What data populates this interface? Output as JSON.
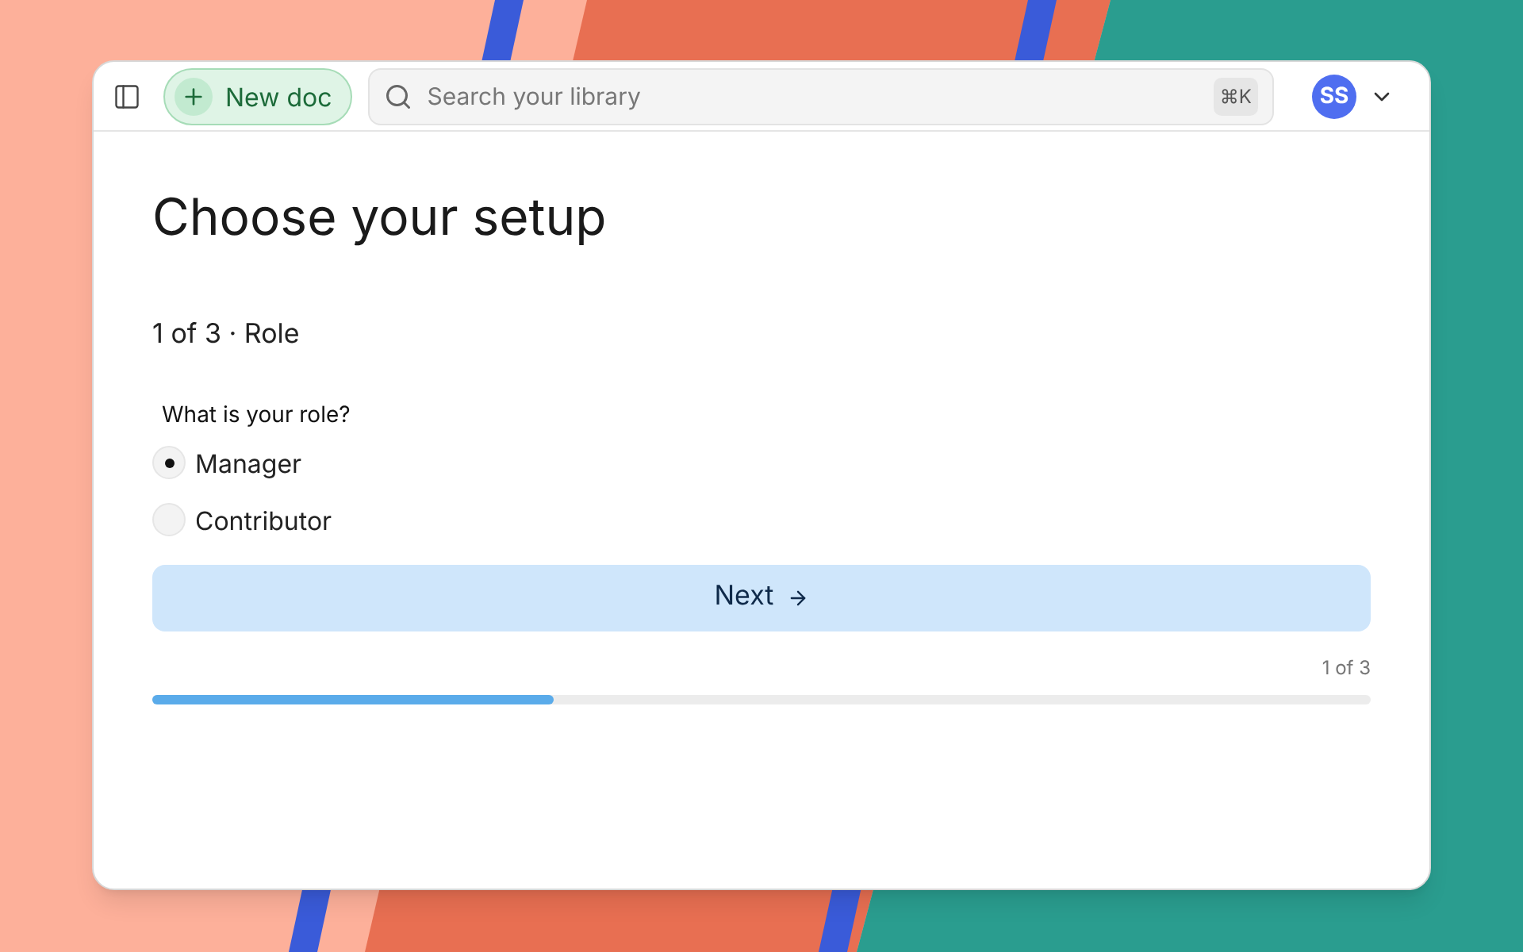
{
  "toolbar": {
    "new_doc": "New doc",
    "search": {
      "placeholder": "Search your library",
      "shortcut": "⌘K"
    },
    "avatar": "SS"
  },
  "title": "Choose your setup",
  "step": "1 of 3 · Role",
  "question": "What is your role?",
  "options": [
    {
      "label": "Manager",
      "selected": true
    },
    {
      "label": "Contributor",
      "selected": false
    }
  ],
  "next_button": "Next",
  "progress": {
    "reading": "1 of 3",
    "level": 0.33
  }
}
